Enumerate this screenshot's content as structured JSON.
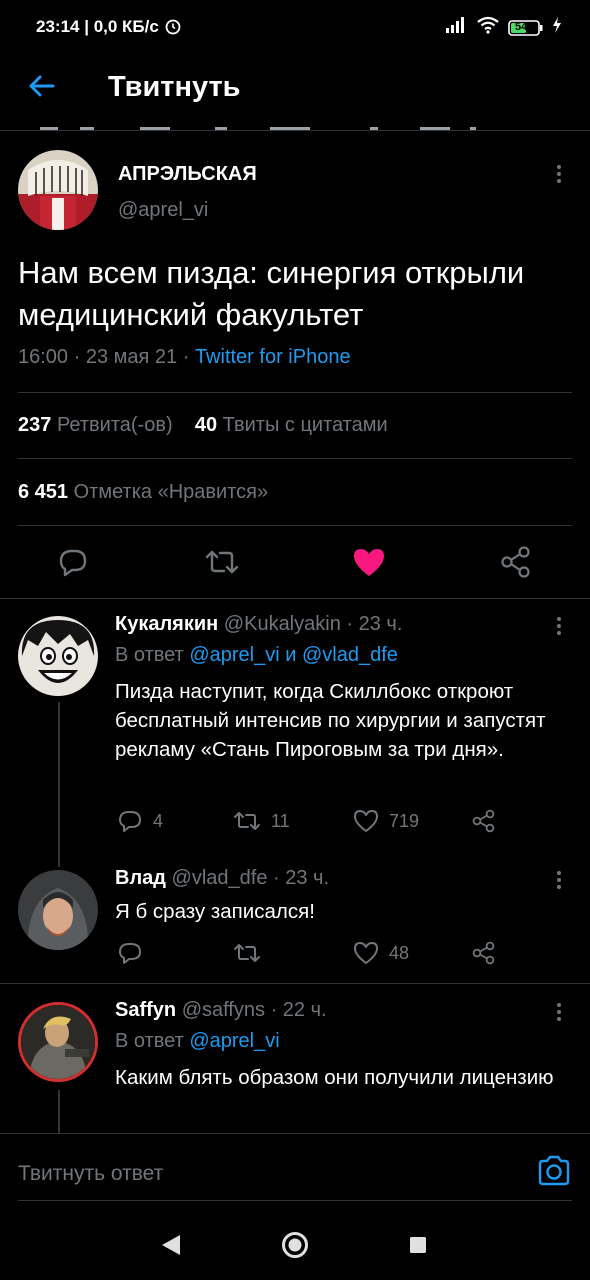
{
  "status_bar": {
    "time": "23:14",
    "network_speed": "0,0 КБ/с",
    "battery": "54"
  },
  "header": {
    "title": "Твитнуть"
  },
  "tweet": {
    "display_name": "АПРЭЛЬСКАЯ",
    "handle": "@aprel_vi",
    "text": "Нам всем пизда: синергия открыли медицинский факультет",
    "time": "16:00",
    "date": "23 мая 21",
    "source": "Twitter for iPhone",
    "retweets_count": "237",
    "retweets_label": "Ретвита(-ов)",
    "quotes_count": "40",
    "quotes_label": "Твиты с цитатами",
    "likes_count": "6 451",
    "likes_label": "Отметка «Нравится»",
    "liked": true
  },
  "replies": [
    {
      "display_name": "Кукалякин",
      "handle": "@Kukalyakin",
      "age": "23 ч.",
      "in_reply_prefix": "В ответ",
      "in_reply_to": "@aprel_vi и @vlad_dfe",
      "text": "Пизда наступит, когда Скиллбокс откроют бесплатный интенсив по хирургии и запустят рекламу «Стань Пироговым за три дня».",
      "replies": "4",
      "retweets": "11",
      "likes": "719"
    },
    {
      "display_name": "Влад",
      "handle": "@vlad_dfe",
      "age": "23 ч.",
      "text": "Я б сразу записался!",
      "replies": "",
      "retweets": "",
      "likes": "48"
    },
    {
      "display_name": "Saffyn",
      "handle": "@saffyns",
      "age": "22 ч.",
      "in_reply_prefix": "В ответ",
      "in_reply_to": "@aprel_vi",
      "text": "Каким блять образом они получили лицензию"
    }
  ],
  "reply_bar": {
    "placeholder": "Твитнуть ответ"
  },
  "colors": {
    "accent": "#1d9bf0",
    "like": "#f91880",
    "muted": "#71767b",
    "background": "#000000"
  }
}
